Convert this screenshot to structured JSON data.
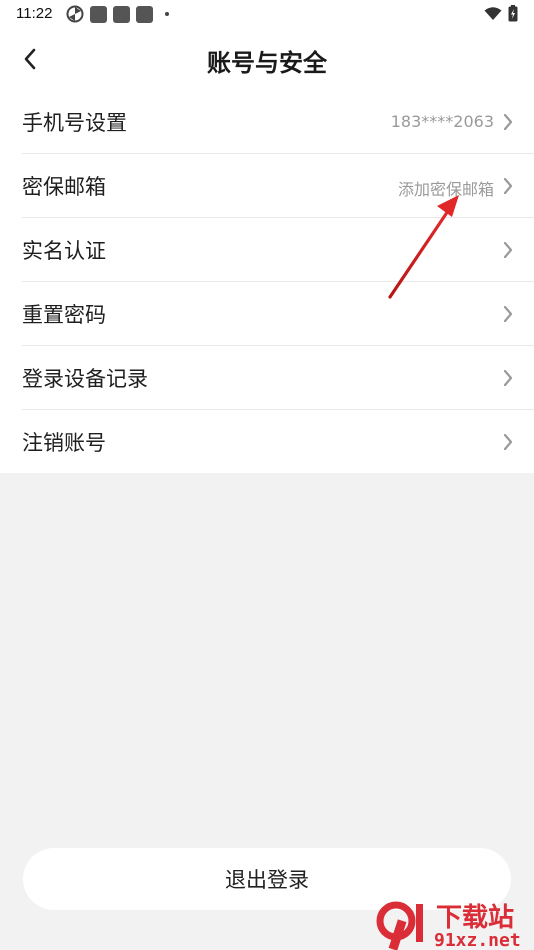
{
  "status_bar": {
    "time": "11:22"
  },
  "header": {
    "title": "账号与安全"
  },
  "settings": {
    "items": [
      {
        "label": "手机号设置",
        "value": "183****2063"
      },
      {
        "label": "密保邮箱",
        "value": "添加密保邮箱"
      },
      {
        "label": "实名认证",
        "value": ""
      },
      {
        "label": "重置密码",
        "value": ""
      },
      {
        "label": "登录设备记录",
        "value": ""
      },
      {
        "label": "注销账号",
        "value": ""
      }
    ]
  },
  "footer": {
    "logout_label": "退出登录"
  },
  "watermark": {
    "text_cn": "下载站",
    "text_en": "91xz.net"
  },
  "colors": {
    "background": "#f2f2f2",
    "card": "#ffffff",
    "annotation_arrow": "#d81e1e",
    "watermark_red": "#d9232d"
  }
}
